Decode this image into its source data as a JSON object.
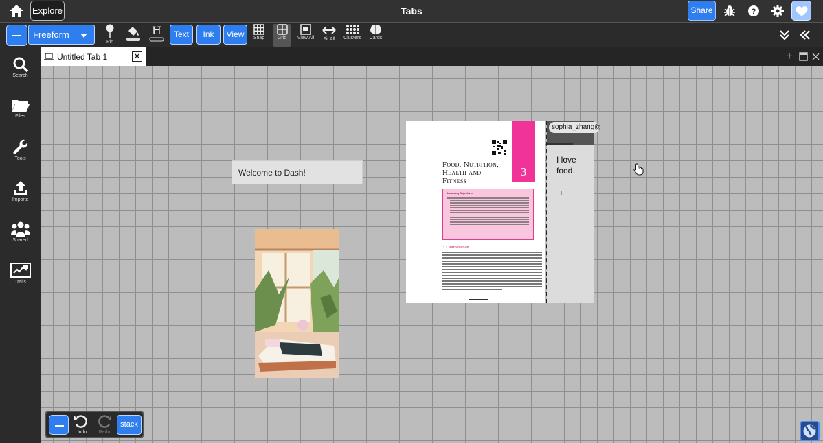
{
  "topbar": {
    "explore_label": "Explore",
    "title": "Tabs",
    "share_label": "Share"
  },
  "toolbar": {
    "mode_value": "Freeform",
    "pin_label": "Pin",
    "text_label": "Text",
    "ink_label": "Ink",
    "view_label": "View",
    "snap_label": "Snap",
    "grid_label": "Grid",
    "view_all_label": "View All",
    "fit_all_label": "Fit All",
    "clusters_label": "Clusters",
    "cards_label": "Cards"
  },
  "sidebar": {
    "items": [
      {
        "label": "Search",
        "icon": "search-icon"
      },
      {
        "label": "Files",
        "icon": "folder-icon"
      },
      {
        "label": "Tools",
        "icon": "wrench-icon"
      },
      {
        "label": "Imports",
        "icon": "upload-icon"
      },
      {
        "label": "Shared",
        "icon": "people-icon"
      },
      {
        "label": "Trails",
        "icon": "presentation-icon"
      }
    ]
  },
  "tabs": [
    {
      "label": "Untitled Tab 1"
    }
  ],
  "canvas": {
    "welcome_text": "Welcome to Dash!",
    "document": {
      "title_lines": [
        "Food, Nutrition,",
        "Health and",
        "Fitness"
      ],
      "chapter_number": "3",
      "objectives_heading": "Learning Objectives",
      "section_heading": "3.1 Introduction"
    },
    "note": {
      "author": "sophia_zhang@",
      "text": "I love food.",
      "add_symbol": "+"
    }
  },
  "bottom": {
    "undo_label": "Undo",
    "redo_label": "Redo",
    "stack_label": "stack"
  },
  "colors": {
    "accent": "#2f7ef0",
    "chapter_pink": "#f03398"
  }
}
